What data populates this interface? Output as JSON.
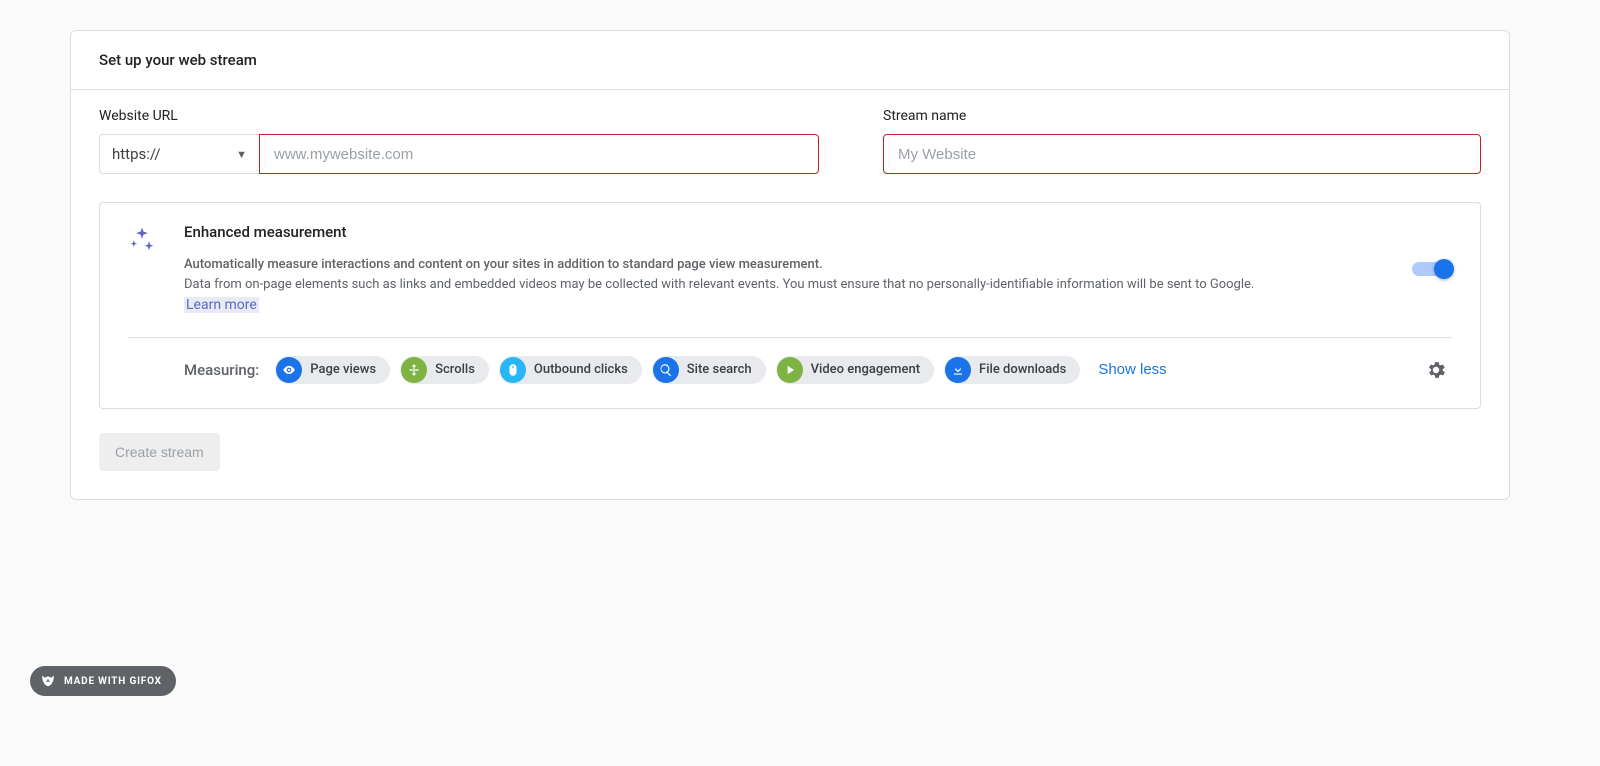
{
  "header": {
    "title": "Set up your web stream"
  },
  "url_field": {
    "label": "Website URL",
    "protocol": "https://",
    "placeholder": "www.mywebsite.com",
    "value": ""
  },
  "name_field": {
    "label": "Stream name",
    "placeholder": "My Website",
    "value": ""
  },
  "enhanced": {
    "title": "Enhanced measurement",
    "desc_bold": "Automatically measure interactions and content on your sites in addition to standard page view measurement.",
    "desc_rest": "Data from on-page elements such as links and embedded videos may be collected with relevant events. You must ensure that no personally-identifiable information will be sent to Google. ",
    "learn_more": "Learn more",
    "toggle_on": true,
    "measuring_label": "Measuring:",
    "chips": [
      {
        "label": "Page views",
        "icon": "eye",
        "color": "ci-blue"
      },
      {
        "label": "Scrolls",
        "icon": "scroll",
        "color": "ci-green"
      },
      {
        "label": "Outbound clicks",
        "icon": "mouse",
        "color": "ci-cyan"
      },
      {
        "label": "Site search",
        "icon": "search",
        "color": "ci-blue"
      },
      {
        "label": "Video engagement",
        "icon": "play",
        "color": "ci-green"
      },
      {
        "label": "File downloads",
        "icon": "download",
        "color": "ci-blue2"
      }
    ],
    "show_less": "Show less"
  },
  "create_button": "Create stream",
  "badge": "MADE WITH GIFOX"
}
